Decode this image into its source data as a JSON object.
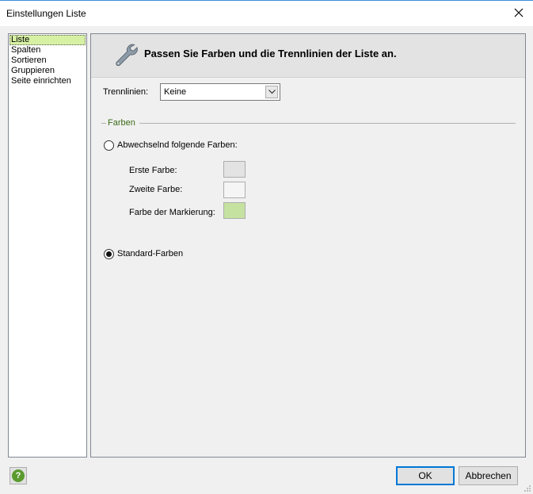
{
  "window": {
    "title": "Einstellungen Liste"
  },
  "nav": {
    "items": [
      "Liste",
      "Spalten",
      "Sortieren",
      "Gruppieren",
      "Seite einrichten"
    ],
    "selected_index": 0
  },
  "panel": {
    "heading": "Passen Sie Farben und die Trennlinien der Liste an.",
    "trennlinien_label": "Trennlinien:",
    "trennlinien_value": "Keine",
    "group_title": "Farben",
    "option_alternating": "Abwechselnd folgende Farben:",
    "erste_farbe_label": "Erste Farbe:",
    "zweite_farbe_label": "Zweite Farbe:",
    "markierung_label": "Farbe der Markierung:",
    "option_standard": "Standard-Farben",
    "selected_option": "standard"
  },
  "colors": {
    "erste_farbe": "#e3e3e3",
    "zweite_farbe": "#f5f5f5",
    "markierung": "#c5e2a0",
    "nav_selected": "#d6f1a4",
    "accent": "#0078d7"
  },
  "footer": {
    "ok_label": "OK",
    "cancel_label": "Abbrechen"
  }
}
